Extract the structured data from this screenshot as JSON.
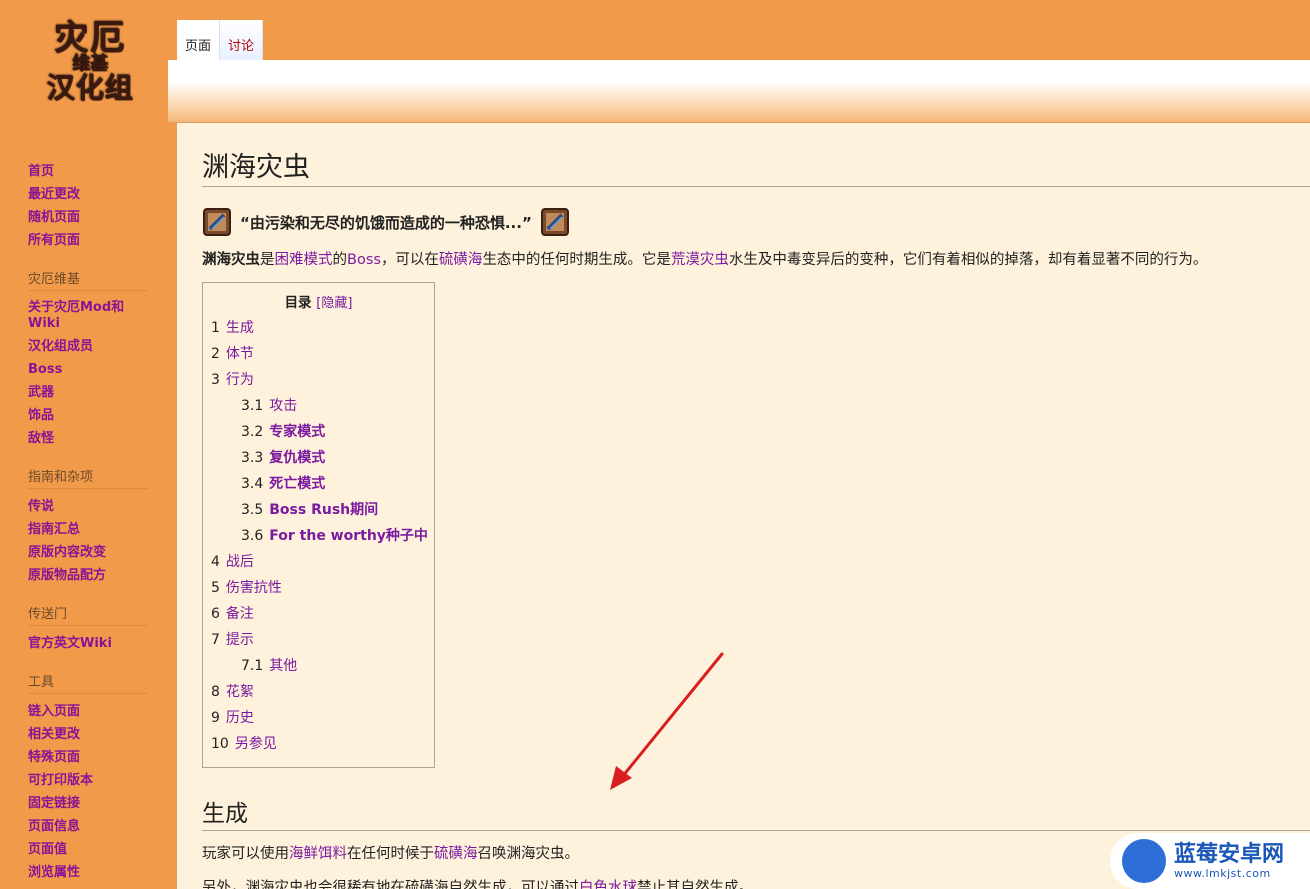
{
  "logo": {
    "line1": "灾厄",
    "line2": "维基",
    "line3": "汉化组"
  },
  "tabs": [
    {
      "label": "页面"
    },
    {
      "label": "讨论"
    }
  ],
  "sidebar": {
    "nav": [
      "首页",
      "最近更改",
      "随机页面",
      "所有页面"
    ],
    "sections": [
      {
        "title": "灾厄维基",
        "items": [
          "关于灾厄Mod和Wiki",
          "汉化组成员",
          "Boss",
          "武器",
          "饰品",
          "敌怪"
        ]
      },
      {
        "title": "指南和杂项",
        "items": [
          "传说",
          "指南汇总",
          "原版内容改变",
          "原版物品配方"
        ]
      },
      {
        "title": "传送门",
        "items": [
          "官方英文Wiki"
        ]
      },
      {
        "title": "工具",
        "items": [
          "链入页面",
          "相关更改",
          "特殊页面",
          "可打印版本",
          "固定链接",
          "页面信息",
          "页面值",
          "浏览属性"
        ]
      }
    ]
  },
  "article": {
    "title": "渊海灾虫",
    "quote": "“由污染和无尽的饥饿而造成的一种恐惧...”",
    "intro": {
      "bold": "渊海灾虫",
      "t1": "是",
      "link1": "困难模式",
      "t2": "的",
      "link2": "Boss",
      "t3": "，可以在",
      "link3": "硫磺海",
      "t4": "生态中的任何时期生成。它是",
      "link4": "荒漠灾虫",
      "t5": "水生及中毒变异后的变种，它们有着相似的掉落，却有着显著不同的行为。"
    },
    "toc": {
      "title": "目录",
      "hide": "[隐藏]",
      "items": [
        {
          "num": "1",
          "label": "生成"
        },
        {
          "num": "2",
          "label": "体节"
        },
        {
          "num": "3",
          "label": "行为"
        },
        {
          "num": "3.1",
          "label": "攻击"
        },
        {
          "num": "3.2",
          "label": "专家模式"
        },
        {
          "num": "3.3",
          "label": "复仇模式"
        },
        {
          "num": "3.4",
          "label": "死亡模式"
        },
        {
          "num": "3.5",
          "label": "Boss Rush期间"
        },
        {
          "num": "3.6",
          "label": "For the worthy种子中"
        },
        {
          "num": "4",
          "label": "战后"
        },
        {
          "num": "5",
          "label": "伤害抗性"
        },
        {
          "num": "6",
          "label": "备注"
        },
        {
          "num": "7",
          "label": "提示"
        },
        {
          "num": "7.1",
          "label": "其他"
        },
        {
          "num": "8",
          "label": "花絮"
        },
        {
          "num": "9",
          "label": "历史"
        },
        {
          "num": "10",
          "label": "另参见"
        }
      ]
    },
    "section1": {
      "heading": "生成",
      "p1": {
        "t1": "玩家可以使用",
        "link1": "海鲜饵料",
        "t2": "在任何时候于",
        "link2": "硫磺海",
        "t3": "召唤渊海灾虫。"
      },
      "p2": {
        "t1": "另外，渊海灾虫也会很稀有地在硫磺海自然生成，可以通过",
        "link1": "白色水球",
        "t2": "禁止其自然生成。"
      }
    }
  },
  "watermark": {
    "title": "蓝莓安卓网",
    "url": "www.lmkjst.com"
  }
}
